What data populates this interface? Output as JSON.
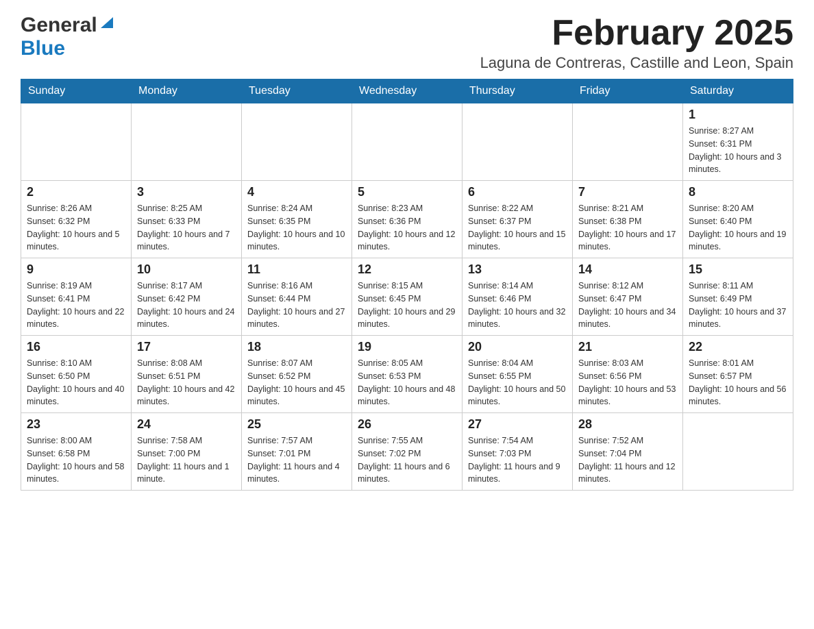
{
  "header": {
    "logo": {
      "general": "General",
      "blue": "Blue",
      "aria": "GeneralBlue logo"
    },
    "title": "February 2025",
    "location": "Laguna de Contreras, Castille and Leon, Spain"
  },
  "days_of_week": [
    "Sunday",
    "Monday",
    "Tuesday",
    "Wednesday",
    "Thursday",
    "Friday",
    "Saturday"
  ],
  "weeks": [
    {
      "days": [
        {
          "num": "",
          "info": ""
        },
        {
          "num": "",
          "info": ""
        },
        {
          "num": "",
          "info": ""
        },
        {
          "num": "",
          "info": ""
        },
        {
          "num": "",
          "info": ""
        },
        {
          "num": "",
          "info": ""
        },
        {
          "num": "1",
          "info": "Sunrise: 8:27 AM\nSunset: 6:31 PM\nDaylight: 10 hours and 3 minutes."
        }
      ]
    },
    {
      "days": [
        {
          "num": "2",
          "info": "Sunrise: 8:26 AM\nSunset: 6:32 PM\nDaylight: 10 hours and 5 minutes."
        },
        {
          "num": "3",
          "info": "Sunrise: 8:25 AM\nSunset: 6:33 PM\nDaylight: 10 hours and 7 minutes."
        },
        {
          "num": "4",
          "info": "Sunrise: 8:24 AM\nSunset: 6:35 PM\nDaylight: 10 hours and 10 minutes."
        },
        {
          "num": "5",
          "info": "Sunrise: 8:23 AM\nSunset: 6:36 PM\nDaylight: 10 hours and 12 minutes."
        },
        {
          "num": "6",
          "info": "Sunrise: 8:22 AM\nSunset: 6:37 PM\nDaylight: 10 hours and 15 minutes."
        },
        {
          "num": "7",
          "info": "Sunrise: 8:21 AM\nSunset: 6:38 PM\nDaylight: 10 hours and 17 minutes."
        },
        {
          "num": "8",
          "info": "Sunrise: 8:20 AM\nSunset: 6:40 PM\nDaylight: 10 hours and 19 minutes."
        }
      ]
    },
    {
      "days": [
        {
          "num": "9",
          "info": "Sunrise: 8:19 AM\nSunset: 6:41 PM\nDaylight: 10 hours and 22 minutes."
        },
        {
          "num": "10",
          "info": "Sunrise: 8:17 AM\nSunset: 6:42 PM\nDaylight: 10 hours and 24 minutes."
        },
        {
          "num": "11",
          "info": "Sunrise: 8:16 AM\nSunset: 6:44 PM\nDaylight: 10 hours and 27 minutes."
        },
        {
          "num": "12",
          "info": "Sunrise: 8:15 AM\nSunset: 6:45 PM\nDaylight: 10 hours and 29 minutes."
        },
        {
          "num": "13",
          "info": "Sunrise: 8:14 AM\nSunset: 6:46 PM\nDaylight: 10 hours and 32 minutes."
        },
        {
          "num": "14",
          "info": "Sunrise: 8:12 AM\nSunset: 6:47 PM\nDaylight: 10 hours and 34 minutes."
        },
        {
          "num": "15",
          "info": "Sunrise: 8:11 AM\nSunset: 6:49 PM\nDaylight: 10 hours and 37 minutes."
        }
      ]
    },
    {
      "days": [
        {
          "num": "16",
          "info": "Sunrise: 8:10 AM\nSunset: 6:50 PM\nDaylight: 10 hours and 40 minutes."
        },
        {
          "num": "17",
          "info": "Sunrise: 8:08 AM\nSunset: 6:51 PM\nDaylight: 10 hours and 42 minutes."
        },
        {
          "num": "18",
          "info": "Sunrise: 8:07 AM\nSunset: 6:52 PM\nDaylight: 10 hours and 45 minutes."
        },
        {
          "num": "19",
          "info": "Sunrise: 8:05 AM\nSunset: 6:53 PM\nDaylight: 10 hours and 48 minutes."
        },
        {
          "num": "20",
          "info": "Sunrise: 8:04 AM\nSunset: 6:55 PM\nDaylight: 10 hours and 50 minutes."
        },
        {
          "num": "21",
          "info": "Sunrise: 8:03 AM\nSunset: 6:56 PM\nDaylight: 10 hours and 53 minutes."
        },
        {
          "num": "22",
          "info": "Sunrise: 8:01 AM\nSunset: 6:57 PM\nDaylight: 10 hours and 56 minutes."
        }
      ]
    },
    {
      "days": [
        {
          "num": "23",
          "info": "Sunrise: 8:00 AM\nSunset: 6:58 PM\nDaylight: 10 hours and 58 minutes."
        },
        {
          "num": "24",
          "info": "Sunrise: 7:58 AM\nSunset: 7:00 PM\nDaylight: 11 hours and 1 minute."
        },
        {
          "num": "25",
          "info": "Sunrise: 7:57 AM\nSunset: 7:01 PM\nDaylight: 11 hours and 4 minutes."
        },
        {
          "num": "26",
          "info": "Sunrise: 7:55 AM\nSunset: 7:02 PM\nDaylight: 11 hours and 6 minutes."
        },
        {
          "num": "27",
          "info": "Sunrise: 7:54 AM\nSunset: 7:03 PM\nDaylight: 11 hours and 9 minutes."
        },
        {
          "num": "28",
          "info": "Sunrise: 7:52 AM\nSunset: 7:04 PM\nDaylight: 11 hours and 12 minutes."
        },
        {
          "num": "",
          "info": ""
        }
      ]
    }
  ]
}
